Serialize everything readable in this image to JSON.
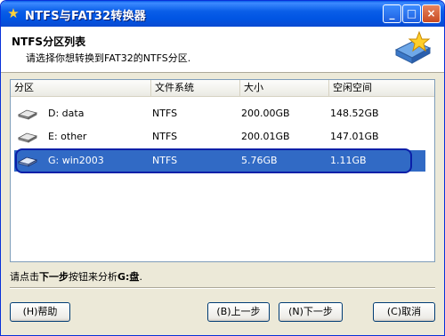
{
  "window": {
    "title": "NTFS与FAT32转换器"
  },
  "titlebar_buttons": {
    "minimize": "_",
    "maximize": "□",
    "close": "×"
  },
  "header": {
    "title": "NTFS分区列表",
    "subtitle": "请选择你想转换到FAT32的NTFS分区."
  },
  "list": {
    "columns": [
      "分区",
      "文件系统",
      "大小",
      "空闲空间"
    ],
    "rows": [
      {
        "partition": "D: data",
        "filesystem": "NTFS",
        "size": "200.00GB",
        "free": "148.52GB",
        "selected": false
      },
      {
        "partition": "E: other",
        "filesystem": "NTFS",
        "size": "200.01GB",
        "free": "147.01GB",
        "selected": false
      },
      {
        "partition": "G: win2003",
        "filesystem": "NTFS",
        "size": "5.76GB",
        "free": "1.11GB",
        "selected": true
      }
    ]
  },
  "status": {
    "prefix": "请点击",
    "bold": "下一步",
    "middle": "按钮来分析",
    "drive": "G:盘",
    "suffix": "."
  },
  "buttons": {
    "help": "(H)帮助",
    "back": "(B)上一步",
    "next": "(N)下一步",
    "cancel": "(C)取消"
  },
  "colors": {
    "selection": "#316ac5",
    "titlebar": "#0054e3",
    "focus_ring": "#0a1fa8"
  }
}
